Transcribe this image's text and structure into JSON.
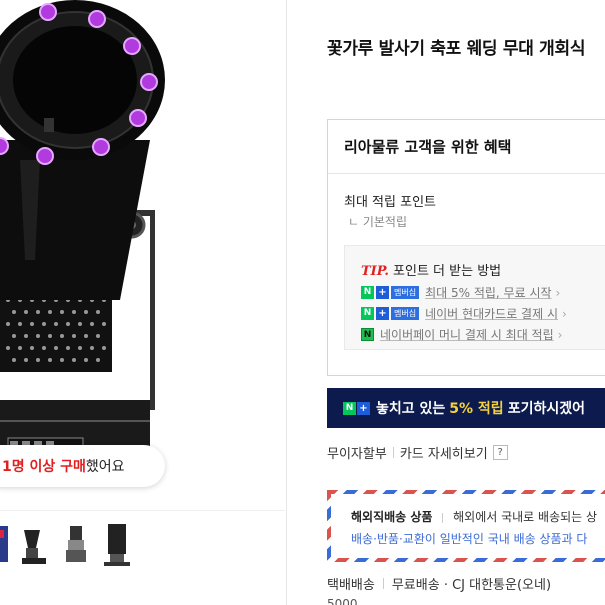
{
  "product": {
    "title": "꽃가루 발사기 축포 웨딩 무대 개회식",
    "buy_badge": {
      "highlight": "1명 이상 구매",
      "suffix": " 했어요"
    }
  },
  "benefits": {
    "title": "리아물류 고객을 위한 혜택",
    "max_point_label": "최대 적립 포인트",
    "basic_point_label": "ㄴ 기본적립",
    "tip": {
      "tag": "TIP.",
      "heading": "포인트 더 받는 방법",
      "rows": [
        {
          "badge": "멤버십",
          "text": "최대 5% 적립, 무료 시작"
        },
        {
          "badge": "멤버십",
          "text": "네이버 현대카드로 결제 시"
        },
        {
          "badge": "",
          "text": "네이버페이 머니 결제 시 최대 적립"
        }
      ]
    }
  },
  "banner": {
    "prefix": "놓치고 있는",
    "percent": "5% 적립",
    "suffix": "포기하시겠어"
  },
  "links": {
    "installment": "무이자할부",
    "card_detail": "카드 자세히보기",
    "help": "?"
  },
  "airmail": {
    "label": "해외직배송 상품",
    "desc": "해외에서 국내로 배송되는 상",
    "notice": "배송·반품·교환이 일반적인 국내 배송 상품과 다"
  },
  "delivery": {
    "method": "택배배송",
    "type": "무료배송 · CJ 대한통운(오네)",
    "fee": "5000"
  },
  "colors": {
    "accent_red": "#e02020",
    "banner_bg": "#0c1a4e",
    "banner_pct": "#f5d23c",
    "npay_green": "#03c75a",
    "led_purple": "#b23be0"
  }
}
